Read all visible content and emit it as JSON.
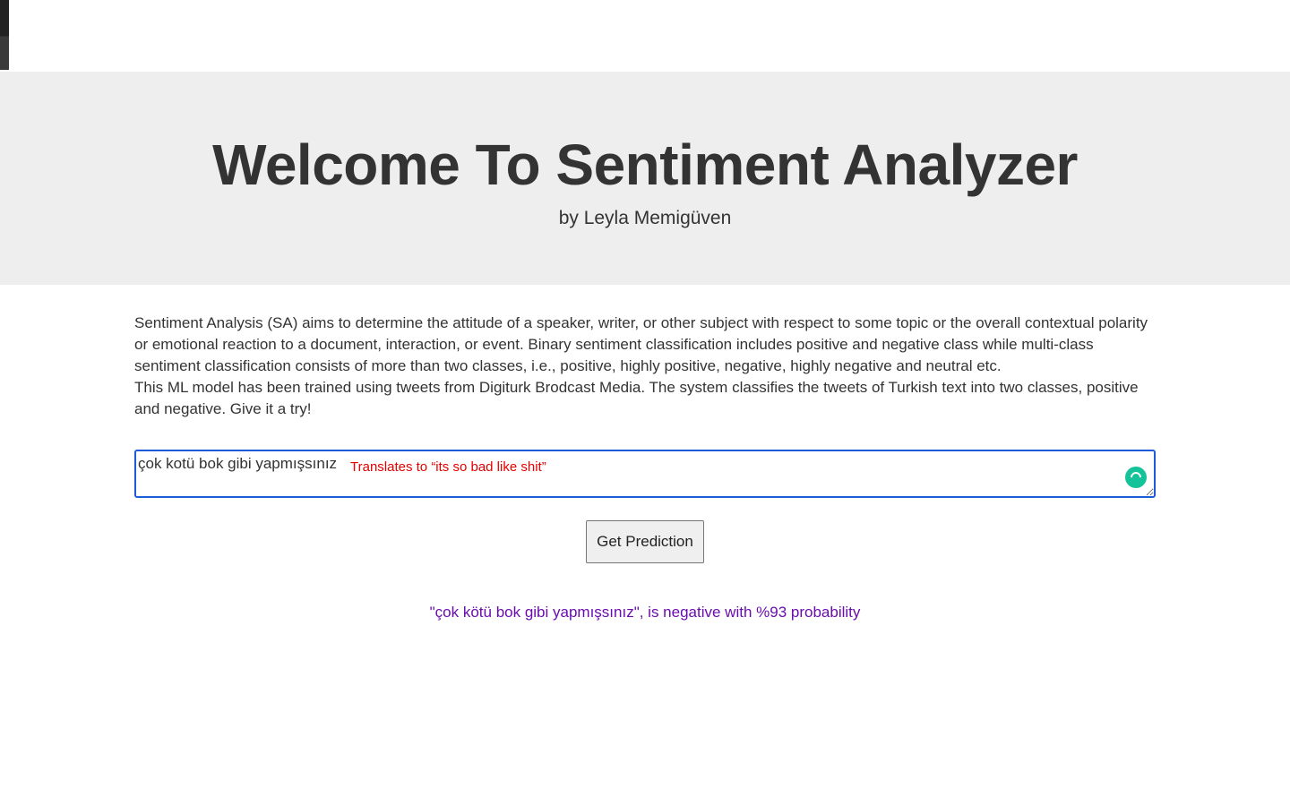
{
  "hero": {
    "title": "Welcome To Sentiment Analyzer",
    "byline": "by Leyla Memigüven"
  },
  "intro": {
    "paragraph1": "Sentiment Analysis (SA) aims to determine the attitude of a speaker, writer, or other subject with respect to some topic or the overall contextual polarity or emotional reaction to a document, interaction, or event. Binary sentiment classification includes positive and negative class while multi-class sentiment classification consists of more than two classes, i.e., positive, highly positive, negative, highly negative and neutral etc.",
    "paragraph2": "This ML model has been trained using tweets from Digiturk Brodcast Media. The system classifies the tweets of Turkish text into two classes, positive and negative. Give it a try!"
  },
  "form": {
    "input_value": "çok kotü bok gibi yapmışsınız",
    "annotation": "Translates to “its so bad like shit”",
    "submit_label": "Get Prediction"
  },
  "result": {
    "text": "\"çok kötü bok gibi yapmışsınız\", is negative with %93 probability"
  },
  "colors": {
    "hero_bg": "#eeeeee",
    "input_border": "#1d5bd8",
    "annotation": "#e60000",
    "result": "#6a0dad",
    "grammarly": "#15c39a"
  },
  "icons": {
    "grammarly": "grammarly-icon"
  }
}
